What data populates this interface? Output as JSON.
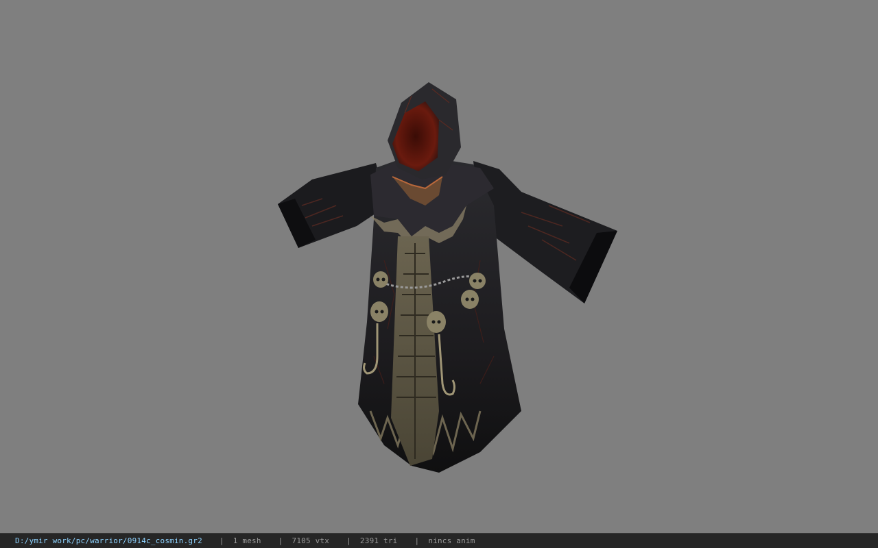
{
  "viewer": {
    "background_color": "#7f7f7f",
    "model_name": "hooded dark robe"
  },
  "status": {
    "file_path": "D:/ymir work/pc/warrior/0914c_cosmin.gr2",
    "separator": "|",
    "mesh": "1 mesh",
    "vertices": "7105 vtx",
    "triangles": "2391 tri",
    "animation": "nincs anim",
    "path_color": "#8fd3ff",
    "text_color": "#9a9a9a"
  }
}
